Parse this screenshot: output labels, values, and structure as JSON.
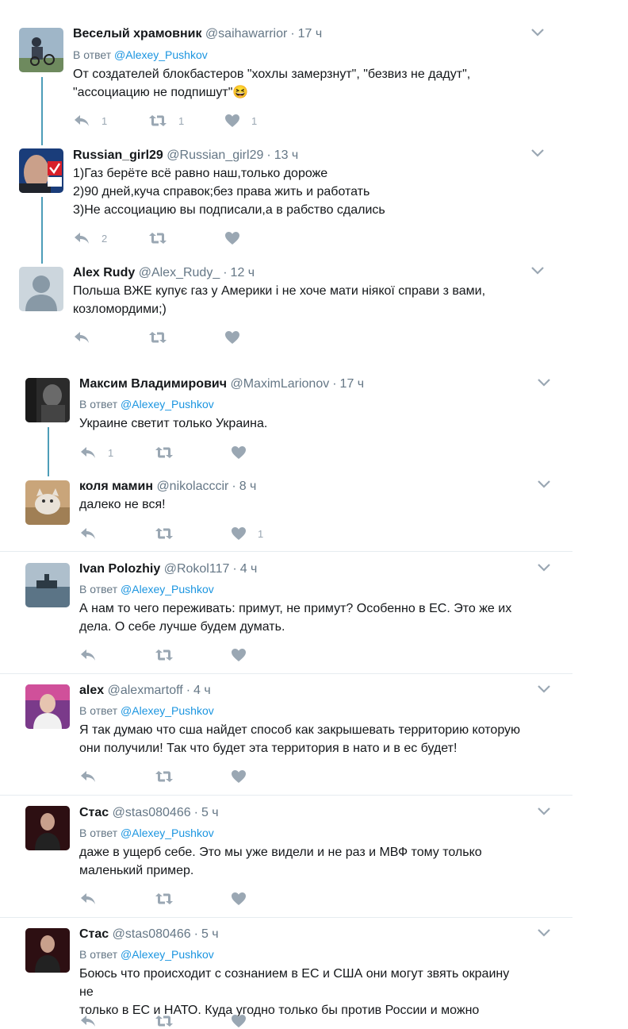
{
  "colors": {
    "text": "#14171a",
    "muted": "#657786",
    "link": "#1b95e0",
    "icon": "#9aa7b3",
    "thread": "#4d9db8",
    "divider": "#e6ecf0"
  },
  "icons": {
    "reply": "reply-icon",
    "retweet": "retweet-icon",
    "like": "heart-icon",
    "more": "chevron-down-icon"
  },
  "tweets": [
    {
      "name": "Веселый храмовник",
      "handle": "@saihawarrior",
      "time": "17 ч",
      "reply_prefix": "В ответ",
      "reply_to": "@Alexey_Pushkov",
      "text": "От создателей блокбастеров \"хохлы замерзнут\", \"безвиз не дадут\",\n\"ассоциацию не подпишут\"😆",
      "replies": "1",
      "retweets": "1",
      "likes": "1"
    },
    {
      "name": "Russian_girl29",
      "handle": "@Russian_girl29",
      "time": "13 ч",
      "reply_prefix": "",
      "reply_to": "",
      "text": "1)Газ берёте всё равно наш,только дороже\n2)90 дней,куча справок;без права жить и работать\n3)Не ассоциацию вы подписали,а в рабство сдались",
      "replies": "2",
      "retweets": "",
      "likes": ""
    },
    {
      "name": "Alex Rudy",
      "handle": "@Alex_Rudy_",
      "time": "12 ч",
      "reply_prefix": "",
      "reply_to": "",
      "text": "Польша ВЖЕ купує газ у Америки і не хоче мати ніякої справи з вами,\nкозломордими;)",
      "replies": "",
      "retweets": "",
      "likes": ""
    },
    {
      "name": "Максим Владимирович",
      "handle": "@MaximLarionov",
      "time": "17 ч",
      "reply_prefix": "В ответ",
      "reply_to": "@Alexey_Pushkov",
      "text": "Украине светит только Украина.",
      "replies": "1",
      "retweets": "",
      "likes": ""
    },
    {
      "name": "коля мамин",
      "handle": "@nikolacccir",
      "time": "8 ч",
      "reply_prefix": "",
      "reply_to": "",
      "text": "далеко не вся!",
      "replies": "",
      "retweets": "",
      "likes": "1"
    },
    {
      "name": "Ivan Polozhiy",
      "handle": "@Rokol117",
      "time": "4 ч",
      "reply_prefix": "В ответ",
      "reply_to": "@Alexey_Pushkov",
      "text": "А нам то чего переживать: примут, не примут? Особенно в ЕС. Это же их\nдела. О себе лучше будем думать.",
      "replies": "",
      "retweets": "",
      "likes": ""
    },
    {
      "name": "alex",
      "handle": "@alexmartoff",
      "time": "4 ч",
      "reply_prefix": "В ответ",
      "reply_to": "@Alexey_Pushkov",
      "text": "Я так думаю что сша найдет способ как закрышевать территорию которую\nони получили! Так что будет эта территория в нато и в ес будет!",
      "replies": "",
      "retweets": "",
      "likes": ""
    },
    {
      "name": "Стас",
      "handle": "@stas080466",
      "time": "5 ч",
      "reply_prefix": "В ответ",
      "reply_to": "@Alexey_Pushkov",
      "text": "даже в ущерб себе. Это мы уже видели и не раз и МВФ тому только\nмаленький пример.",
      "replies": "",
      "retweets": "",
      "likes": ""
    },
    {
      "name": "Стас",
      "handle": "@stas080466",
      "time": "5 ч",
      "reply_prefix": "В ответ",
      "reply_to": "@Alexey_Pushkov",
      "text": "Боюсь что происходит с сознанием в ЕС и США они могут звять окраину не\nтолько в ЕС и НАТО. Куда угодно только бы против России и можно",
      "replies": "",
      "retweets": "",
      "likes": ""
    }
  ]
}
